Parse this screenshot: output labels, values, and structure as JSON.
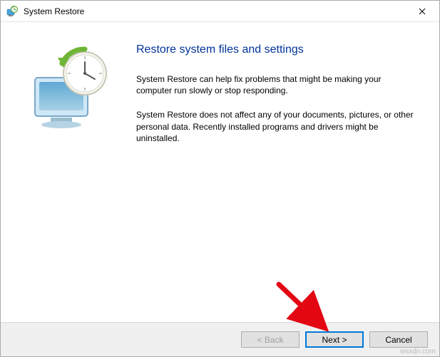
{
  "titlebar": {
    "title": "System Restore"
  },
  "main": {
    "heading": "Restore system files and settings",
    "paragraph1": "System Restore can help fix problems that might be making your computer run slowly or stop responding.",
    "paragraph2": "System Restore does not affect any of your documents, pictures, or other personal data. Recently installed programs and drivers might be uninstalled."
  },
  "buttons": {
    "back": "< Back",
    "next": "Next >",
    "cancel": "Cancel"
  },
  "watermark": "wsxdn.com"
}
